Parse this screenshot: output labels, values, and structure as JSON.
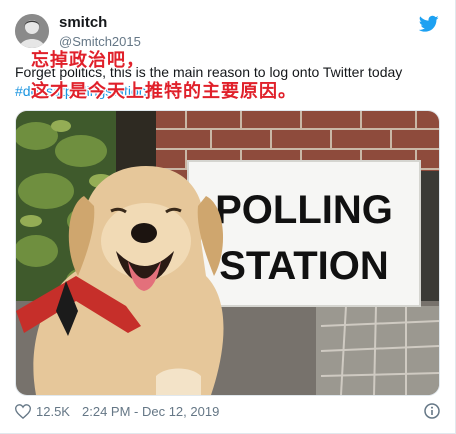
{
  "author": {
    "display_name": "smitch",
    "handle": "@Smitch2015"
  },
  "tweet": {
    "text": "Forget politics, this is the main reason to log onto Twitter today",
    "hashtags": "#dogsatpollingstations",
    "overlay_line1": "忘掉政治吧，",
    "overlay_line2": "这才是今天上推特的主要原因。"
  },
  "photo": {
    "sign_line1": "POLLING",
    "sign_line2": "STATION"
  },
  "footer": {
    "likes": "12.5K",
    "timestamp": "2:24 PM - Dec 12, 2019"
  },
  "icons": {
    "brand": "twitter-bird-icon",
    "like": "heart-icon",
    "info": "info-icon"
  },
  "colors": {
    "link": "#1b95e0",
    "brand": "#1da1f2",
    "overlay_text": "#e0202a",
    "muted": "#657786"
  }
}
